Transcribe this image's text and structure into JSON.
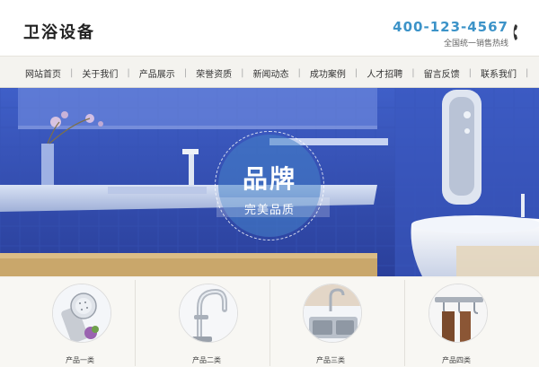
{
  "header": {
    "logo_text": "卫浴设备",
    "hotline_number": "400-123-4567",
    "hotline_label": "全国统一销售热线"
  },
  "nav": {
    "items": [
      {
        "label": "网站首页"
      },
      {
        "label": "关于我们"
      },
      {
        "label": "产品展示"
      },
      {
        "label": "荣誉资质"
      },
      {
        "label": "新闻动态"
      },
      {
        "label": "成功案例"
      },
      {
        "label": "人才招聘"
      },
      {
        "label": "留言反馈"
      },
      {
        "label": "联系我们"
      }
    ],
    "separator": "|"
  },
  "banner": {
    "title": "品牌",
    "subtitle": "完美品质"
  },
  "products": [
    {
      "caption": "产品一类",
      "icon": "shower-head-icon"
    },
    {
      "caption": "产品二类",
      "icon": "faucet-icon"
    },
    {
      "caption": "产品三类",
      "icon": "sink-icon"
    },
    {
      "caption": "产品四类",
      "icon": "towel-hook-icon"
    }
  ],
  "colors": {
    "accent": "#3c93c8",
    "banner_blue": "#2f4fb0"
  }
}
